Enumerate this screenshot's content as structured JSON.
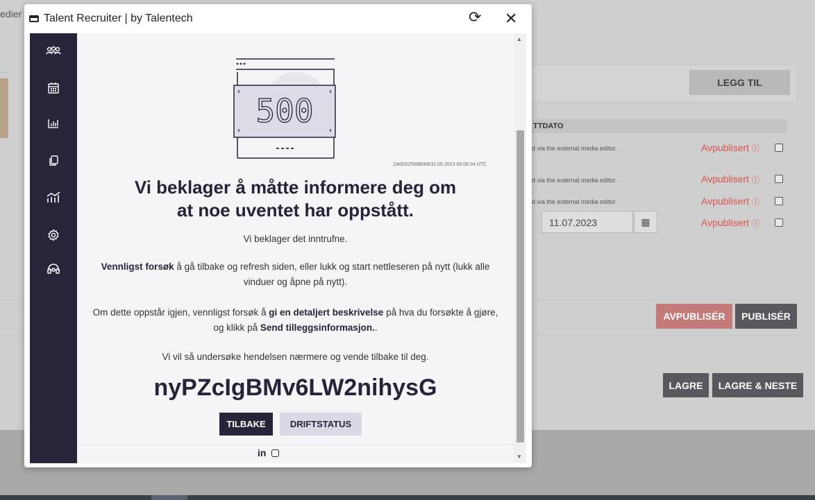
{
  "background": {
    "tab_fragment": "edier",
    "link_fragment": "...",
    "legg_til": "LEGG TIL",
    "column_header": "TTDATO",
    "rows": [
      {
        "note": "d via the external media editor.",
        "status": "Avpublisert"
      },
      {
        "note": "d via the external media editor.",
        "status": "Avpublisert"
      },
      {
        "note": "d via the external media editor.",
        "status": "Avpublisert"
      },
      {
        "note": "",
        "status": "Avpublisert"
      }
    ],
    "date_value": "11.07.2023",
    "avpubliser": "AVPUBLISÉR",
    "publiser": "PUBLISÉR",
    "lagre": "LAGRE",
    "lagre_neste": "LAGRE & NESTE"
  },
  "modal": {
    "title": "Talent Recruiter | by Talentech",
    "sidebar_icons": [
      "candidates-icon",
      "calendar-icon",
      "reports-icon",
      "copy-icon",
      "analytics-icon",
      "settings-icon",
      "support-icon"
    ],
    "error_graphic_text": "500",
    "error_id": "ZA00S25WB069/31.05.2023 08.08.04 UTC",
    "headline_line1": "Vi beklager å måtte informere deg om",
    "headline_line2": "at noe uventet har oppstått.",
    "p1": "Vi beklager det inntrufne.",
    "p2_bold": "Vennligst forsøk",
    "p2_rest": " å gå tilbake og refresh siden, eller lukk og start nettleseren på nytt (lukk alle vinduer og åpne på nytt).",
    "p3_a": "Om dette oppstår igjen, vennligst forsøk å ",
    "p3_bold1": "gi en detaljert beskrivelse",
    "p3_b": " på hva du forsøkte å gjøre, og klikk på ",
    "p3_bold2": "Send tilleggsinformasjon.",
    "p3_c": ".",
    "p4": "Vi vil så undersøke hendelsen nærmere og vende tilbake til deg.",
    "token": "nyPZcIgBMv6LW2nihysG",
    "btn_back": "TILBAKE",
    "btn_status": "DRIFTSTATUS",
    "social_linkedin": "in"
  }
}
